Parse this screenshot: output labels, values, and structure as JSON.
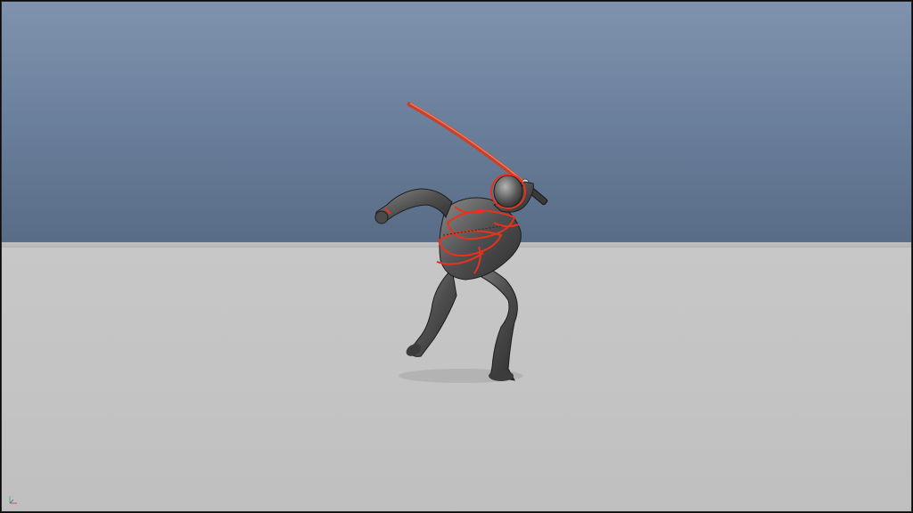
{
  "viewport": {
    "name": "3D viewport",
    "background": {
      "sky_top": "#7f93ae",
      "sky_bottom": "#576b85",
      "ground": "#c4c4c4"
    }
  },
  "character": {
    "material": "gray-mannequin",
    "rig_color": "#e8321e",
    "pose": "katana-overhead-strike"
  },
  "hud": {
    "axis_gizmo_icon": "axis-gizmo-icon",
    "frame_label": ""
  }
}
